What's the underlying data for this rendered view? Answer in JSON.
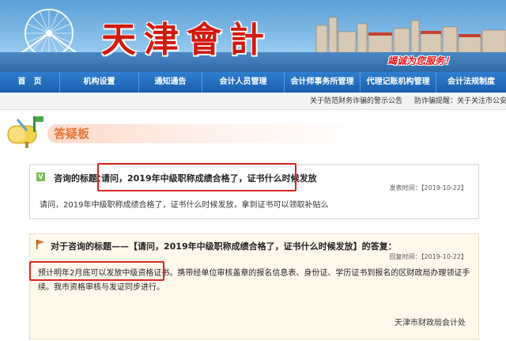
{
  "banner": {
    "title": "天津會計",
    "slogan": "竭诚为您服务！"
  },
  "nav": [
    {
      "label": "首　页"
    },
    {
      "label": "机构设置"
    },
    {
      "label": "通知通告"
    },
    {
      "label": "会计人员管理"
    },
    {
      "label": "会计师事务所管理"
    },
    {
      "label": "代理记账机构管理"
    },
    {
      "label": "会计法规制度"
    }
  ],
  "ticker": {
    "item1": "关于防范财务诈骗的警示公告",
    "item2": "防诈骗提醒：关于关注市公安局"
  },
  "board": {
    "title": "答疑板"
  },
  "question": {
    "label": "咨询的标题：",
    "title": "请问，2019年中级职称成绩合格了，证书什么时候发放",
    "date": "发表时间：【2019-10-22】",
    "body": "请问，2019年中级职称成绩合格了，证书什么时候发放，拿到证书可以领取补贴么"
  },
  "answer": {
    "label": "对于咨询的标题——【请问，2019年中级职称成绩合格了，证书什么时候发放】的答复：",
    "date": "回复时间：【2019-10-22】",
    "highlight": "预计明年2月底可以发放中级资格证书。",
    "body_rest": "携带经单位审核盖章的报名信息表、身份证、学历证书到报名的区财政局办理领证手续。我市资格审核与发证同步进行。",
    "signature": "天津市财政局会计处"
  }
}
